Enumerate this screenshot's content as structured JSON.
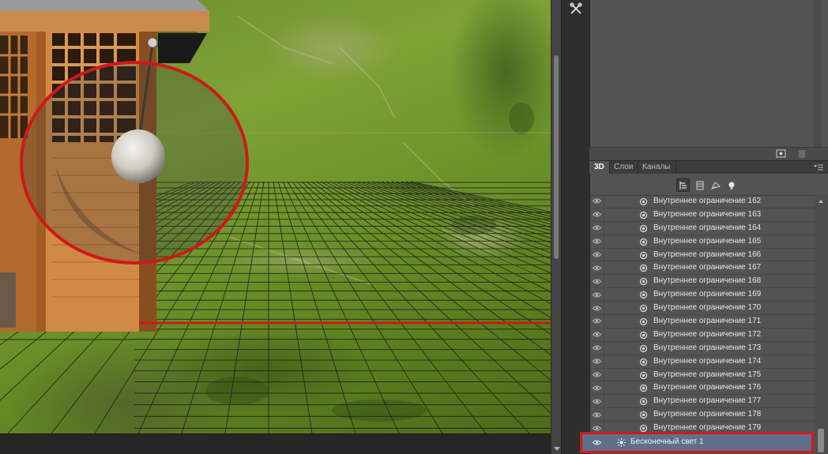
{
  "tabs": [
    {
      "label": "3D",
      "active": true
    },
    {
      "label": "Слои",
      "active": false
    },
    {
      "label": "Каналы",
      "active": false
    }
  ],
  "panel_3d": {
    "filter_icons": [
      "whole-scene-filter-icon",
      "meshes-filter-icon",
      "materials-filter-icon",
      "lights-filter-icon"
    ],
    "items": [
      {
        "label": "Внутреннее ограничение 162",
        "icon": "constraint-icon"
      },
      {
        "label": "Внутреннее ограничение 163",
        "icon": "constraint-icon"
      },
      {
        "label": "Внутреннее ограничение 164",
        "icon": "constraint-icon"
      },
      {
        "label": "Внутреннее ограничение 165",
        "icon": "constraint-icon"
      },
      {
        "label": "Внутреннее ограничение 166",
        "icon": "constraint-icon"
      },
      {
        "label": "Внутреннее ограничение 167",
        "icon": "constraint-icon"
      },
      {
        "label": "Внутреннее ограничение 168",
        "icon": "constraint-icon"
      },
      {
        "label": "Внутреннее ограничение 169",
        "icon": "constraint-icon"
      },
      {
        "label": "Внутреннее ограничение 170",
        "icon": "constraint-icon"
      },
      {
        "label": "Внутреннее ограничение 171",
        "icon": "constraint-icon"
      },
      {
        "label": "Внутреннее ограничение 172",
        "icon": "constraint-icon"
      },
      {
        "label": "Внутреннее ограничение 173",
        "icon": "constraint-icon"
      },
      {
        "label": "Внутреннее ограничение 174",
        "icon": "constraint-icon"
      },
      {
        "label": "Внутреннее ограничение 175",
        "icon": "constraint-icon"
      },
      {
        "label": "Внутреннее ограничение 176",
        "icon": "constraint-icon"
      },
      {
        "label": "Внутреннее ограничение 177",
        "icon": "constraint-icon"
      },
      {
        "label": "Внутреннее ограничение 178",
        "icon": "constraint-icon"
      },
      {
        "label": "Внутреннее ограничение 179",
        "icon": "constraint-icon"
      }
    ],
    "selected_item": {
      "label": "Бесконечный свет 1",
      "icon": "infinite-light-icon"
    }
  },
  "colors": {
    "highlight_red": "#d01818",
    "panel_bg": "#535353",
    "selected_row": "#5f6f8a"
  }
}
